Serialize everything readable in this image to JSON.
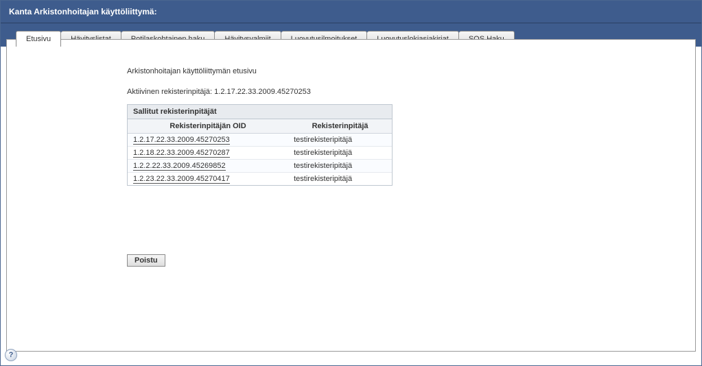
{
  "window": {
    "title": "Kanta Arkistonhoitajan käyttöliittymä:"
  },
  "tabs": [
    {
      "label": "Etusivu",
      "active": true
    },
    {
      "label": "Hävityslistat",
      "active": false
    },
    {
      "label": "Potilaskohtainen haku",
      "active": false
    },
    {
      "label": "Hävitysvalmiit",
      "active": false
    },
    {
      "label": "Luovutusilmoitukset",
      "active": false
    },
    {
      "label": "Luovutuslokiasiakirjat",
      "active": false
    },
    {
      "label": "SOS Haku",
      "active": false
    }
  ],
  "main": {
    "heading": "Arkistonhoitajan käyttöliittymän etusivu",
    "active_registrar_label": "Aktiivinen rekisterinpitäjä: ",
    "active_registrar_value": "1.2.17.22.33.2009.45270253"
  },
  "allowed_panel": {
    "title": "Sallitut rekisterinpitäjät",
    "columns": {
      "oid": "Rekisterinpitäjän OID",
      "name": "Rekisterinpitäjä"
    },
    "rows": [
      {
        "oid": "1.2.17.22.33.2009.45270253",
        "name": "testirekisteripitäjä"
      },
      {
        "oid": "1.2.18.22.33.2009.45270287",
        "name": "testirekisteripitäjä"
      },
      {
        "oid": "1.2.2.22.33.2009.45269852",
        "name": "testirekisteripitäjä"
      },
      {
        "oid": "1.2.23.22.33.2009.45270417",
        "name": "testirekisteripitäjä"
      }
    ]
  },
  "buttons": {
    "logout": "Poistu"
  },
  "help_icon": "?"
}
